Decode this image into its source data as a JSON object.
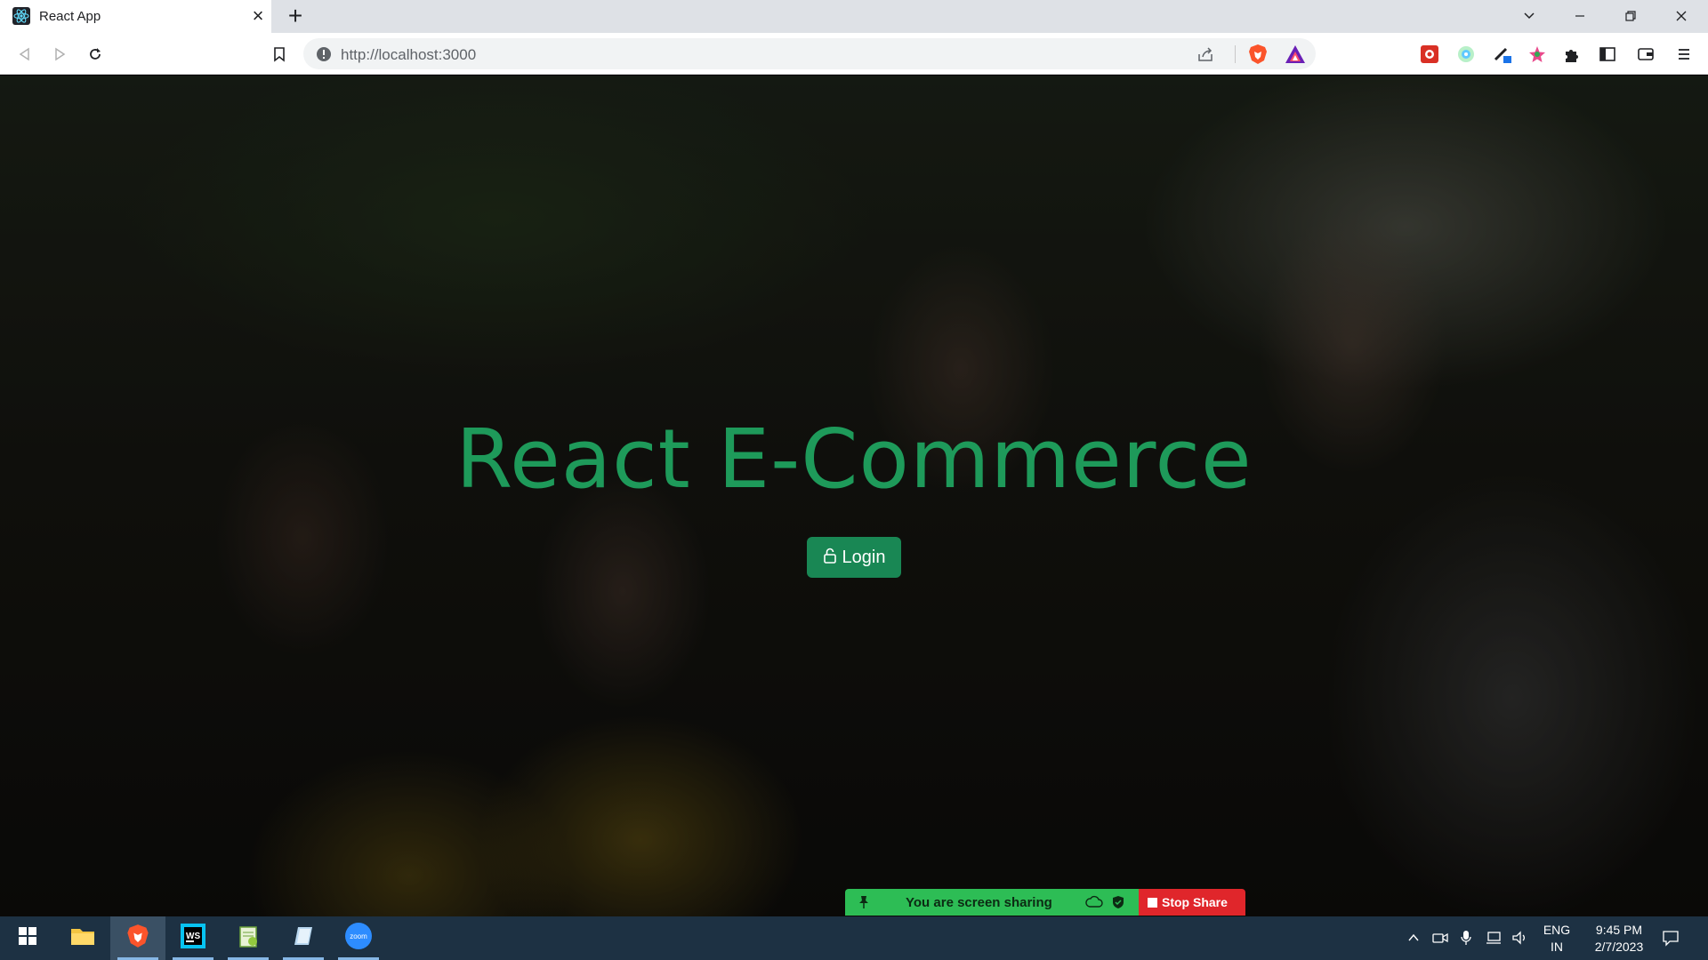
{
  "browser": {
    "tab_title": "React App",
    "new_tab": "+",
    "url": "http://localhost:3000"
  },
  "page": {
    "hero_title": "React E-Commerce",
    "login_label": "Login"
  },
  "screen_share": {
    "status": "You are screen sharing",
    "stop_label": "Stop Share"
  },
  "taskbar": {
    "apps": [
      "start",
      "file-explorer",
      "brave",
      "webstorm",
      "notepad-plus-plus",
      "notes",
      "zoom"
    ],
    "lang_line1": "ENG",
    "lang_line2": "IN",
    "time": "9:45 PM",
    "date": "2/7/2023"
  },
  "colors": {
    "accent_green": "#198754",
    "title_green": "#1e9a5a",
    "share_green": "#2dbd55",
    "stop_red": "#e0262b",
    "taskbar": "#1d3143"
  }
}
